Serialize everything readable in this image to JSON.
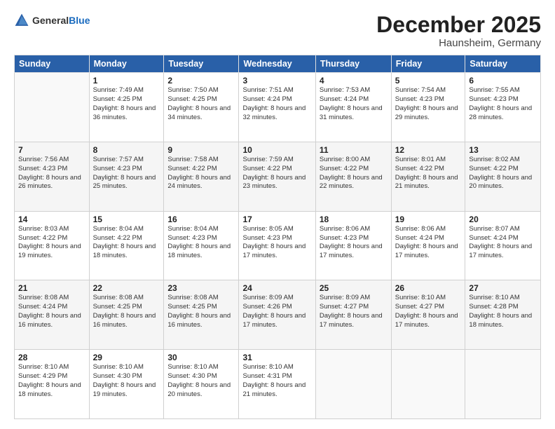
{
  "header": {
    "logo_general": "General",
    "logo_blue": "Blue",
    "month_year": "December 2025",
    "location": "Haunsheim, Germany"
  },
  "weekdays": [
    "Sunday",
    "Monday",
    "Tuesday",
    "Wednesday",
    "Thursday",
    "Friday",
    "Saturday"
  ],
  "weeks": [
    [
      {
        "day": "",
        "sunrise": "",
        "sunset": "",
        "daylight": ""
      },
      {
        "day": "1",
        "sunrise": "Sunrise: 7:49 AM",
        "sunset": "Sunset: 4:25 PM",
        "daylight": "Daylight: 8 hours and 36 minutes."
      },
      {
        "day": "2",
        "sunrise": "Sunrise: 7:50 AM",
        "sunset": "Sunset: 4:25 PM",
        "daylight": "Daylight: 8 hours and 34 minutes."
      },
      {
        "day": "3",
        "sunrise": "Sunrise: 7:51 AM",
        "sunset": "Sunset: 4:24 PM",
        "daylight": "Daylight: 8 hours and 32 minutes."
      },
      {
        "day": "4",
        "sunrise": "Sunrise: 7:53 AM",
        "sunset": "Sunset: 4:24 PM",
        "daylight": "Daylight: 8 hours and 31 minutes."
      },
      {
        "day": "5",
        "sunrise": "Sunrise: 7:54 AM",
        "sunset": "Sunset: 4:23 PM",
        "daylight": "Daylight: 8 hours and 29 minutes."
      },
      {
        "day": "6",
        "sunrise": "Sunrise: 7:55 AM",
        "sunset": "Sunset: 4:23 PM",
        "daylight": "Daylight: 8 hours and 28 minutes."
      }
    ],
    [
      {
        "day": "7",
        "sunrise": "Sunrise: 7:56 AM",
        "sunset": "Sunset: 4:23 PM",
        "daylight": "Daylight: 8 hours and 26 minutes."
      },
      {
        "day": "8",
        "sunrise": "Sunrise: 7:57 AM",
        "sunset": "Sunset: 4:23 PM",
        "daylight": "Daylight: 8 hours and 25 minutes."
      },
      {
        "day": "9",
        "sunrise": "Sunrise: 7:58 AM",
        "sunset": "Sunset: 4:22 PM",
        "daylight": "Daylight: 8 hours and 24 minutes."
      },
      {
        "day": "10",
        "sunrise": "Sunrise: 7:59 AM",
        "sunset": "Sunset: 4:22 PM",
        "daylight": "Daylight: 8 hours and 23 minutes."
      },
      {
        "day": "11",
        "sunrise": "Sunrise: 8:00 AM",
        "sunset": "Sunset: 4:22 PM",
        "daylight": "Daylight: 8 hours and 22 minutes."
      },
      {
        "day": "12",
        "sunrise": "Sunrise: 8:01 AM",
        "sunset": "Sunset: 4:22 PM",
        "daylight": "Daylight: 8 hours and 21 minutes."
      },
      {
        "day": "13",
        "sunrise": "Sunrise: 8:02 AM",
        "sunset": "Sunset: 4:22 PM",
        "daylight": "Daylight: 8 hours and 20 minutes."
      }
    ],
    [
      {
        "day": "14",
        "sunrise": "Sunrise: 8:03 AM",
        "sunset": "Sunset: 4:22 PM",
        "daylight": "Daylight: 8 hours and 19 minutes."
      },
      {
        "day": "15",
        "sunrise": "Sunrise: 8:04 AM",
        "sunset": "Sunset: 4:22 PM",
        "daylight": "Daylight: 8 hours and 18 minutes."
      },
      {
        "day": "16",
        "sunrise": "Sunrise: 8:04 AM",
        "sunset": "Sunset: 4:23 PM",
        "daylight": "Daylight: 8 hours and 18 minutes."
      },
      {
        "day": "17",
        "sunrise": "Sunrise: 8:05 AM",
        "sunset": "Sunset: 4:23 PM",
        "daylight": "Daylight: 8 hours and 17 minutes."
      },
      {
        "day": "18",
        "sunrise": "Sunrise: 8:06 AM",
        "sunset": "Sunset: 4:23 PM",
        "daylight": "Daylight: 8 hours and 17 minutes."
      },
      {
        "day": "19",
        "sunrise": "Sunrise: 8:06 AM",
        "sunset": "Sunset: 4:24 PM",
        "daylight": "Daylight: 8 hours and 17 minutes."
      },
      {
        "day": "20",
        "sunrise": "Sunrise: 8:07 AM",
        "sunset": "Sunset: 4:24 PM",
        "daylight": "Daylight: 8 hours and 17 minutes."
      }
    ],
    [
      {
        "day": "21",
        "sunrise": "Sunrise: 8:08 AM",
        "sunset": "Sunset: 4:24 PM",
        "daylight": "Daylight: 8 hours and 16 minutes."
      },
      {
        "day": "22",
        "sunrise": "Sunrise: 8:08 AM",
        "sunset": "Sunset: 4:25 PM",
        "daylight": "Daylight: 8 hours and 16 minutes."
      },
      {
        "day": "23",
        "sunrise": "Sunrise: 8:08 AM",
        "sunset": "Sunset: 4:25 PM",
        "daylight": "Daylight: 8 hours and 16 minutes."
      },
      {
        "day": "24",
        "sunrise": "Sunrise: 8:09 AM",
        "sunset": "Sunset: 4:26 PM",
        "daylight": "Daylight: 8 hours and 17 minutes."
      },
      {
        "day": "25",
        "sunrise": "Sunrise: 8:09 AM",
        "sunset": "Sunset: 4:27 PM",
        "daylight": "Daylight: 8 hours and 17 minutes."
      },
      {
        "day": "26",
        "sunrise": "Sunrise: 8:10 AM",
        "sunset": "Sunset: 4:27 PM",
        "daylight": "Daylight: 8 hours and 17 minutes."
      },
      {
        "day": "27",
        "sunrise": "Sunrise: 8:10 AM",
        "sunset": "Sunset: 4:28 PM",
        "daylight": "Daylight: 8 hours and 18 minutes."
      }
    ],
    [
      {
        "day": "28",
        "sunrise": "Sunrise: 8:10 AM",
        "sunset": "Sunset: 4:29 PM",
        "daylight": "Daylight: 8 hours and 18 minutes."
      },
      {
        "day": "29",
        "sunrise": "Sunrise: 8:10 AM",
        "sunset": "Sunset: 4:30 PM",
        "daylight": "Daylight: 8 hours and 19 minutes."
      },
      {
        "day": "30",
        "sunrise": "Sunrise: 8:10 AM",
        "sunset": "Sunset: 4:30 PM",
        "daylight": "Daylight: 8 hours and 20 minutes."
      },
      {
        "day": "31",
        "sunrise": "Sunrise: 8:10 AM",
        "sunset": "Sunset: 4:31 PM",
        "daylight": "Daylight: 8 hours and 21 minutes."
      },
      {
        "day": "",
        "sunrise": "",
        "sunset": "",
        "daylight": ""
      },
      {
        "day": "",
        "sunrise": "",
        "sunset": "",
        "daylight": ""
      },
      {
        "day": "",
        "sunrise": "",
        "sunset": "",
        "daylight": ""
      }
    ]
  ]
}
